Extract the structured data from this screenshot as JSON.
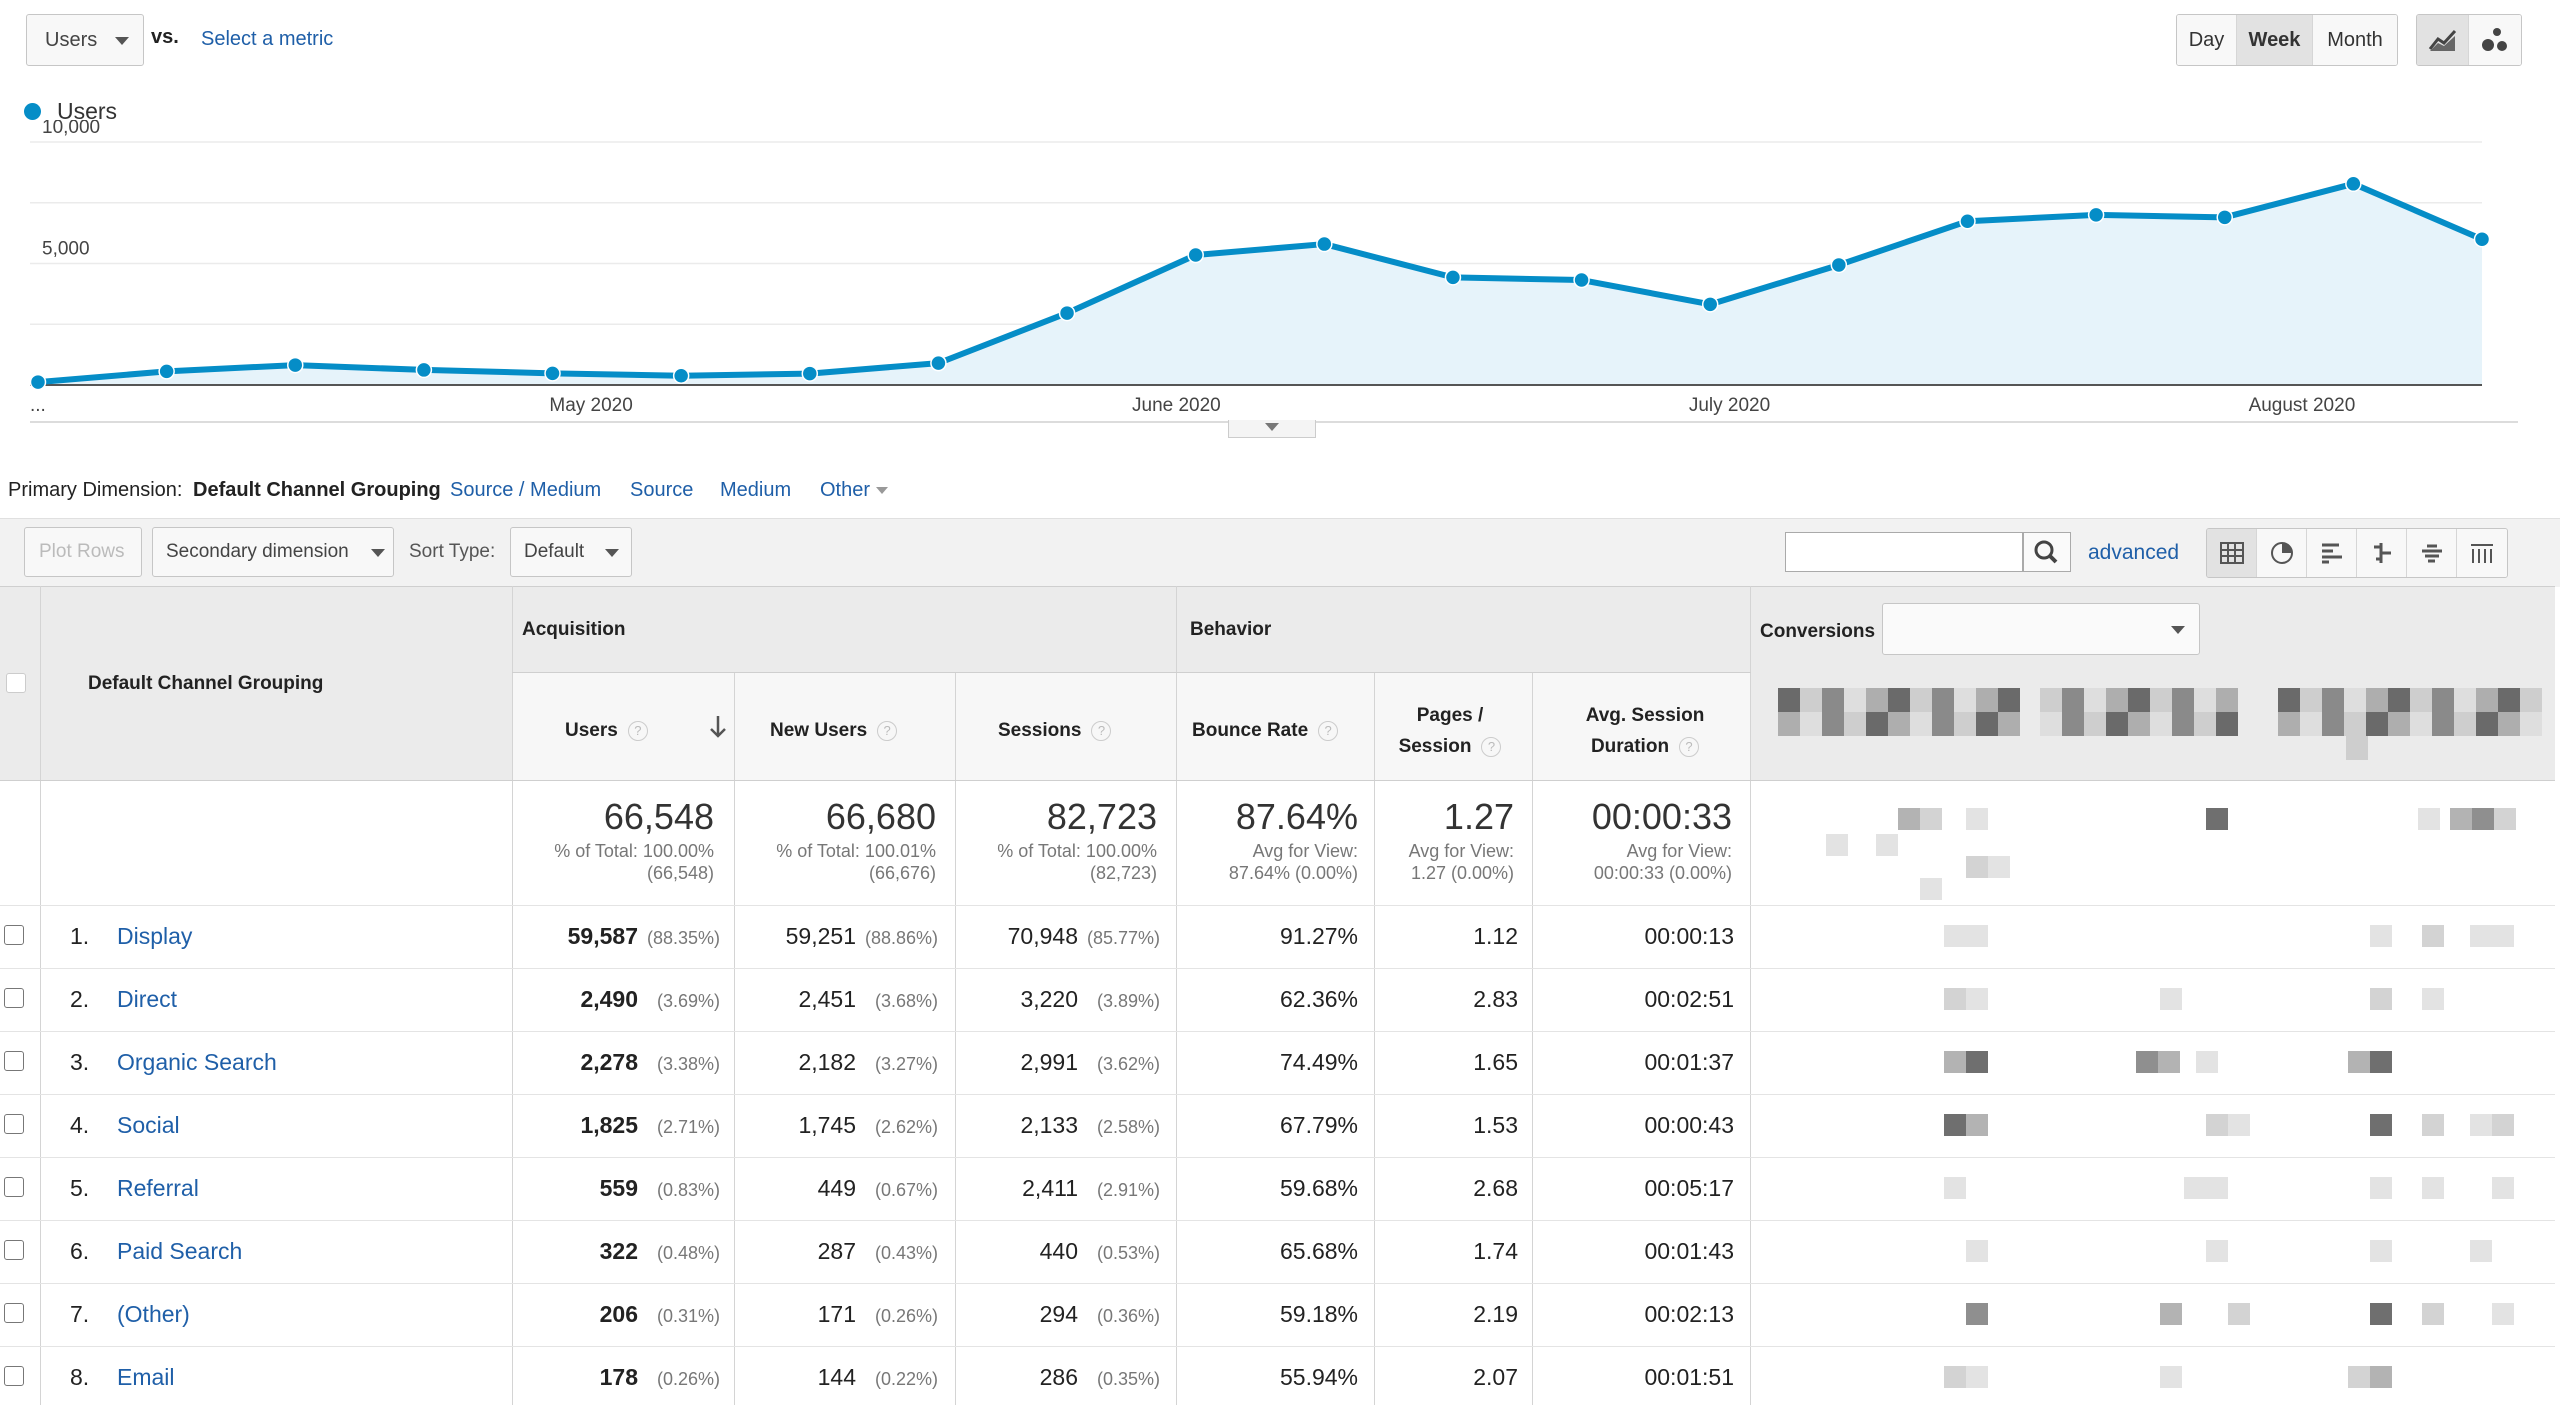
{
  "top": {
    "metric": "Users",
    "vs": "vs.",
    "select_metric": "Select a metric",
    "periods": [
      "Day",
      "Week",
      "Month"
    ],
    "active_period": "Week"
  },
  "legend": {
    "label": "Users",
    "color": "#058dc7"
  },
  "chart_data": {
    "type": "area",
    "y_ticks": [
      "10,000",
      "5,000"
    ],
    "ylim": [
      0,
      10000
    ],
    "x_tick_labels": [
      "...",
      "May 2020",
      "June 2020",
      "July 2020",
      "August 2020"
    ],
    "series": [
      {
        "name": "Users",
        "values": [
          120,
          560,
          820,
          620,
          480,
          380,
          470,
          900,
          2960,
          5350,
          5800,
          4430,
          4320,
          3320,
          4940,
          6740,
          7000,
          6900,
          8280,
          6000
        ]
      }
    ],
    "grid": true
  },
  "dimension": {
    "label": "Primary Dimension:",
    "current": "Default Channel Grouping",
    "options": [
      "Source / Medium",
      "Source",
      "Medium",
      "Other"
    ]
  },
  "toolbar": {
    "plot_rows": "Plot Rows",
    "secondary": "Secondary dimension",
    "sort_label": "Sort Type:",
    "sort_value": "Default",
    "advanced": "advanced"
  },
  "table": {
    "dim_header": "Default Channel Grouping",
    "groups": {
      "acquisition": "Acquisition",
      "behavior": "Behavior",
      "conversions": "Conversions"
    },
    "cols": {
      "users": "Users",
      "new_users": "New Users",
      "sessions": "Sessions",
      "bounce": "Bounce Rate",
      "pages_1": "Pages /",
      "pages_2": "Session",
      "dur_1": "Avg. Session",
      "dur_2": "Duration",
      "help": "?"
    },
    "totals": {
      "users": "66,548",
      "users_s1": "% of Total: 100.00%",
      "users_s2": "(66,548)",
      "new_users": "66,680",
      "new_users_s1": "% of Total: 100.01%",
      "new_users_s2": "(66,676)",
      "sessions": "82,723",
      "sessions_s1": "% of Total: 100.00%",
      "sessions_s2": "(82,723)",
      "bounce": "87.64%",
      "bounce_s1": "Avg for View:",
      "bounce_s2": "87.64% (0.00%)",
      "pages": "1.27",
      "pages_s1": "Avg for View:",
      "pages_s2": "1.27 (0.00%)",
      "dur": "00:00:33",
      "dur_s1": "Avg for View:",
      "dur_s2": "00:00:33 (0.00%)"
    },
    "rows": [
      {
        "n": "1.",
        "name": "Display",
        "users": "59,587",
        "users_pct": "(88.35%)",
        "new": "59,251",
        "new_pct": "(88.86%)",
        "sess": "70,948",
        "sess_pct": "(85.77%)",
        "bounce": "91.27%",
        "pages": "1.12",
        "dur": "00:00:13"
      },
      {
        "n": "2.",
        "name": "Direct",
        "users": "2,490",
        "users_pct": "(3.69%)",
        "new": "2,451",
        "new_pct": "(3.68%)",
        "sess": "3,220",
        "sess_pct": "(3.89%)",
        "bounce": "62.36%",
        "pages": "2.83",
        "dur": "00:02:51"
      },
      {
        "n": "3.",
        "name": "Organic Search",
        "users": "2,278",
        "users_pct": "(3.38%)",
        "new": "2,182",
        "new_pct": "(3.27%)",
        "sess": "2,991",
        "sess_pct": "(3.62%)",
        "bounce": "74.49%",
        "pages": "1.65",
        "dur": "00:01:37"
      },
      {
        "n": "4.",
        "name": "Social",
        "users": "1,825",
        "users_pct": "(2.71%)",
        "new": "1,745",
        "new_pct": "(2.62%)",
        "sess": "2,133",
        "sess_pct": "(2.58%)",
        "bounce": "67.79%",
        "pages": "1.53",
        "dur": "00:00:43"
      },
      {
        "n": "5.",
        "name": "Referral",
        "users": "559",
        "users_pct": "(0.83%)",
        "new": "449",
        "new_pct": "(0.67%)",
        "sess": "2,411",
        "sess_pct": "(2.91%)",
        "bounce": "59.68%",
        "pages": "2.68",
        "dur": "00:05:17"
      },
      {
        "n": "6.",
        "name": "Paid Search",
        "users": "322",
        "users_pct": "(0.48%)",
        "new": "287",
        "new_pct": "(0.43%)",
        "sess": "440",
        "sess_pct": "(0.53%)",
        "bounce": "65.68%",
        "pages": "1.74",
        "dur": "00:01:43"
      },
      {
        "n": "7.",
        "name": "(Other)",
        "users": "206",
        "users_pct": "(0.31%)",
        "new": "171",
        "new_pct": "(0.26%)",
        "sess": "294",
        "sess_pct": "(0.36%)",
        "bounce": "59.18%",
        "pages": "2.19",
        "dur": "00:02:13"
      },
      {
        "n": "8.",
        "name": "Email",
        "users": "178",
        "users_pct": "(0.26%)",
        "new": "144",
        "new_pct": "(0.22%)",
        "sess": "286",
        "sess_pct": "(0.35%)",
        "bounce": "55.94%",
        "pages": "2.07",
        "dur": "00:01:51"
      }
    ]
  }
}
